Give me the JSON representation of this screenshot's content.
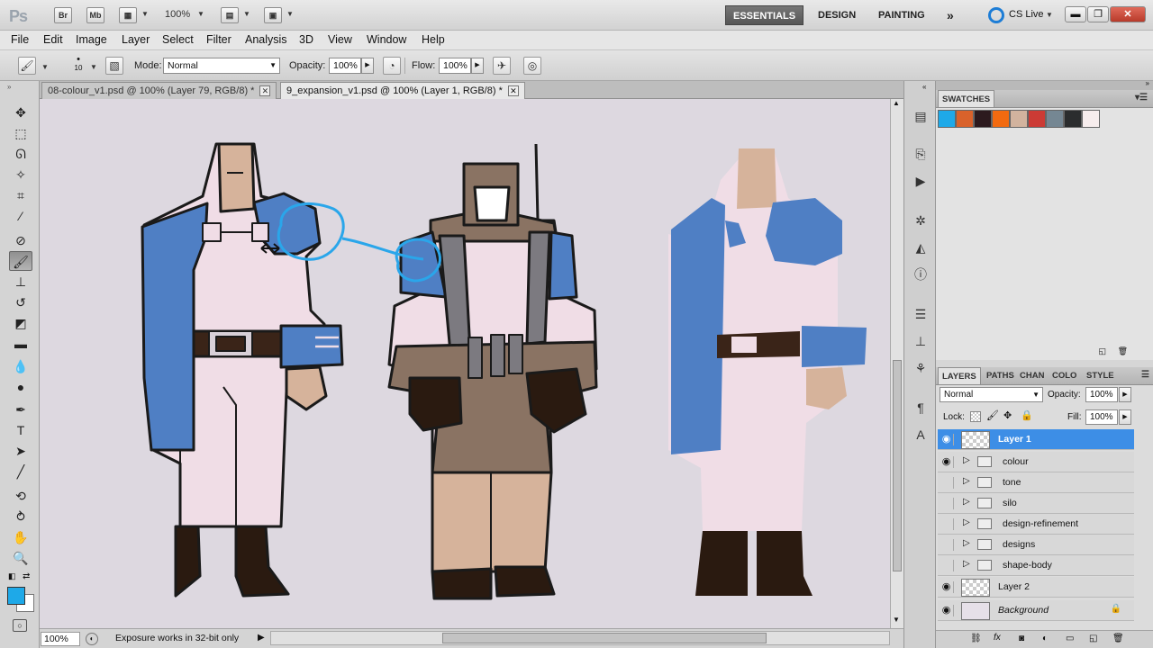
{
  "app": {
    "logo": "Ps",
    "bridge_label": "Br",
    "minibridge_label": "Mb",
    "zoom_value": "100%",
    "workspaces": [
      "ESSENTIALS",
      "DESIGN",
      "PAINTING"
    ],
    "more_workspaces": "»",
    "cs_live": "CS Live"
  },
  "menu": [
    "File",
    "Edit",
    "Image",
    "Layer",
    "Select",
    "Filter",
    "Analysis",
    "3D",
    "View",
    "Window",
    "Help"
  ],
  "options": {
    "brush_size": "10",
    "mode_label": "Mode:",
    "mode_value": "Normal",
    "opacity_label": "Opacity:",
    "opacity_value": "100%",
    "flow_label": "Flow:",
    "flow_value": "100%"
  },
  "tabs": [
    {
      "label": "08-colour_v1.psd @ 100% (Layer 79, RGB/8) *",
      "active": false
    },
    {
      "label": "9_expansion_v1.psd @ 100% (Layer 1, RGB/8) *",
      "active": true
    }
  ],
  "status": {
    "zoom": "100%",
    "message": "Exposure works in 32-bit only"
  },
  "swatches_panel": {
    "title": "SWATCHES",
    "colors": [
      "#1ea9e8",
      "#d9622b",
      "#2c1a1e",
      "#f26a10",
      "#d2b39e",
      "#cc3b35",
      "#758793",
      "#2b2d2e",
      "#f7eded"
    ]
  },
  "layers_panel": {
    "tabs": [
      "LAYERS",
      "PATHS",
      "CHAN",
      "COLO",
      "STYLE"
    ],
    "blend_mode": "Normal",
    "opacity_label": "Opacity:",
    "opacity_value": "100%",
    "lock_label": "Lock:",
    "fill_label": "Fill:",
    "fill_value": "100%",
    "layers": [
      {
        "name": "Layer 1",
        "visible": true,
        "type": "layer",
        "selected": true
      },
      {
        "name": "colour",
        "visible": true,
        "type": "group",
        "selected": false
      },
      {
        "name": "tone",
        "visible": false,
        "type": "group",
        "selected": false
      },
      {
        "name": "silo",
        "visible": false,
        "type": "group",
        "selected": false
      },
      {
        "name": "design-refinement",
        "visible": false,
        "type": "group",
        "selected": false
      },
      {
        "name": "designs",
        "visible": false,
        "type": "group",
        "selected": false
      },
      {
        "name": "shape-body",
        "visible": false,
        "type": "group",
        "selected": false
      },
      {
        "name": "Layer 2",
        "visible": true,
        "type": "layer",
        "selected": false
      },
      {
        "name": "Background",
        "visible": true,
        "type": "background",
        "selected": false
      }
    ]
  }
}
